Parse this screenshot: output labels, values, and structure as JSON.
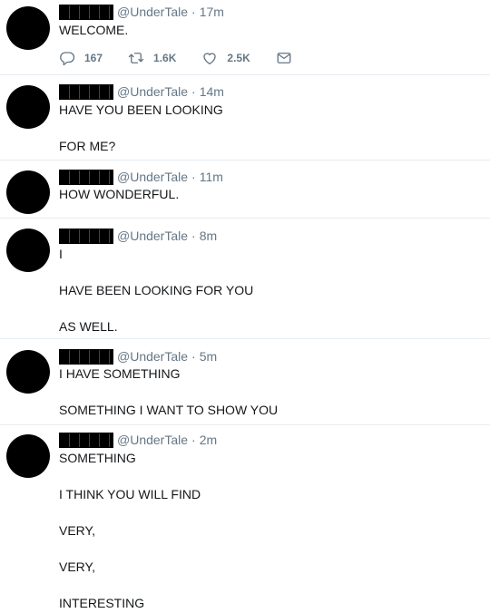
{
  "tweets": [
    {
      "handle": "@UnderTale",
      "separator": "·",
      "time": "17m",
      "lines": [
        "WELCOME."
      ],
      "actions": {
        "reply_count": "167",
        "retweet_count": "1.6K",
        "like_count": "2.5K"
      }
    },
    {
      "handle": "@UnderTale",
      "separator": "·",
      "time": "14m",
      "lines": [
        "HAVE YOU BEEN LOOKING",
        "FOR ME?"
      ]
    },
    {
      "handle": "@UnderTale",
      "separator": "·",
      "time": "11m",
      "lines": [
        "HOW WONDERFUL."
      ]
    },
    {
      "handle": "@UnderTale",
      "separator": "·",
      "time": "8m",
      "lines": [
        "I",
        "HAVE BEEN LOOKING FOR YOU",
        "AS WELL."
      ]
    },
    {
      "handle": "@UnderTale",
      "separator": "·",
      "time": "5m",
      "lines": [
        "I HAVE SOMETHING",
        "SOMETHING I WANT TO SHOW YOU"
      ]
    },
    {
      "handle": "@UnderTale",
      "separator": "·",
      "time": "2m",
      "lines": [
        "SOMETHING",
        "I THINK YOU WILL FIND",
        "VERY,",
        "VERY,",
        "INTERESTING"
      ]
    }
  ],
  "icons": {
    "reply": "reply-icon",
    "retweet": "retweet-icon",
    "like": "heart-icon",
    "message": "envelope-icon"
  },
  "colors": {
    "muted": "#657786",
    "text": "#14171a",
    "divider": "#e6ecf0",
    "avatar": "#000000"
  }
}
